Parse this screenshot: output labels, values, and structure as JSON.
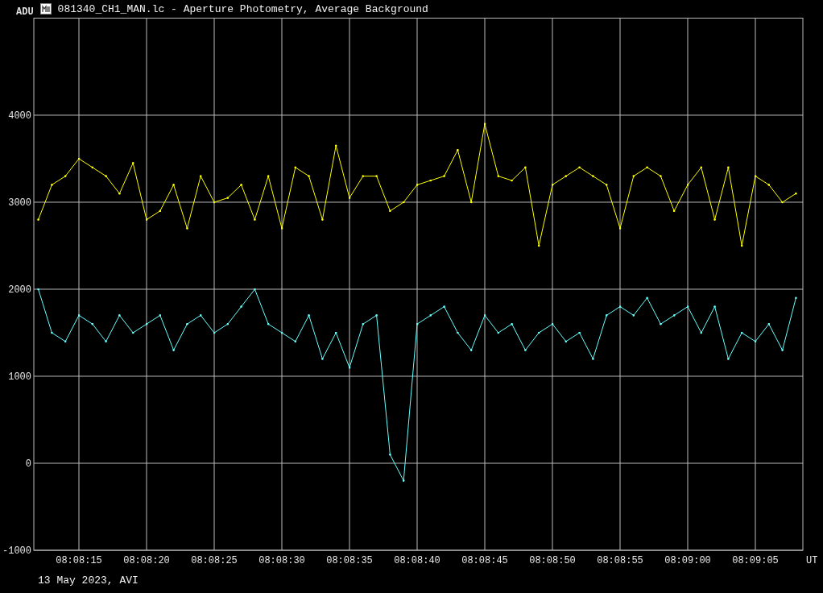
{
  "header": {
    "title": "081340_CH1_MAN.lc - Aperture Photometry, Average Background"
  },
  "chart": {
    "chart_data": {
      "type": "line",
      "ylabel": "ADU",
      "xlabel": "UT",
      "grid": true,
      "ylim": [
        -1000,
        5120
      ],
      "yticks": [
        -1000,
        0,
        1000,
        2000,
        3000,
        4000
      ],
      "categories": [
        null,
        null,
        null,
        "08:08:15",
        null,
        null,
        null,
        null,
        "08:08:20",
        null,
        null,
        null,
        null,
        "08:08:25",
        null,
        null,
        null,
        null,
        "08:08:30",
        null,
        null,
        null,
        null,
        "08:08:35",
        null,
        null,
        null,
        null,
        "08:08:40",
        null,
        null,
        null,
        null,
        "08:08:45",
        null,
        null,
        null,
        null,
        "08:08:50",
        null,
        null,
        null,
        null,
        "08:08:55",
        null,
        null,
        null,
        null,
        "08:09:00",
        null,
        null,
        null,
        null,
        "08:09:05",
        null,
        null,
        null
      ],
      "series": [
        {
          "color": "#ffff00",
          "values": [
            2800,
            3200,
            3300,
            3500,
            3400,
            3300,
            3100,
            3450,
            2800,
            2900,
            3200,
            2700,
            3300,
            3000,
            3050,
            3200,
            2800,
            3300,
            2700,
            3400,
            3300,
            2800,
            3650,
            3050,
            3300,
            3300,
            2900,
            3000,
            3200,
            3250,
            3300,
            3600,
            3000,
            3900,
            3300,
            3250,
            3400,
            2500,
            3200,
            3300,
            3400,
            3300,
            3200,
            2700,
            3300,
            3400,
            3300,
            2900,
            3200,
            3400,
            2800,
            3400,
            2500,
            3300,
            3200,
            3000,
            3100
          ]
        },
        {
          "color": "#66ffff",
          "values": [
            2000,
            1500,
            1400,
            1700,
            1600,
            1400,
            1700,
            1500,
            1600,
            1700,
            1300,
            1600,
            1700,
            1500,
            1600,
            1800,
            2000,
            1600,
            1500,
            1400,
            1700,
            1200,
            1500,
            1100,
            1600,
            1700,
            100,
            -200,
            1600,
            1700,
            1800,
            1500,
            1300,
            1700,
            1500,
            1600,
            1300,
            1500,
            1600,
            1400,
            1500,
            1200,
            1700,
            1800,
            1700,
            1900,
            1600,
            1700,
            1800,
            1500,
            1800,
            1200,
            1500,
            1400,
            1600,
            1300,
            1900
          ]
        }
      ]
    }
  },
  "caption": "13 May 2023, AVI"
}
